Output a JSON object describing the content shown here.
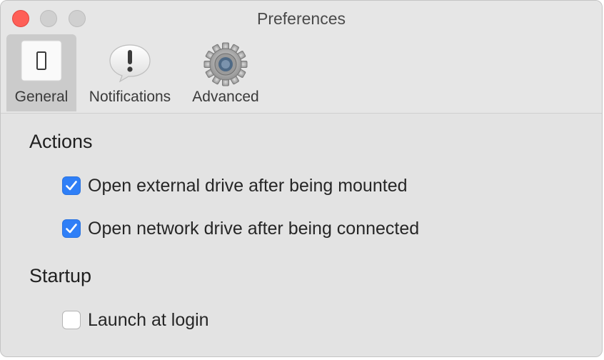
{
  "window": {
    "title": "Preferences"
  },
  "toolbar": {
    "tabs": [
      {
        "label": "General",
        "icon": "switch-icon",
        "selected": true
      },
      {
        "label": "Notifications",
        "icon": "exclamation-bubble-icon",
        "selected": false
      },
      {
        "label": "Advanced",
        "icon": "gear-icon",
        "selected": false
      }
    ]
  },
  "sections": {
    "actions": {
      "title": "Actions",
      "options": [
        {
          "label": "Open external drive after being mounted",
          "checked": true
        },
        {
          "label": "Open network drive after being connected",
          "checked": true
        }
      ]
    },
    "startup": {
      "title": "Startup",
      "options": [
        {
          "label": "Launch at login",
          "checked": false
        }
      ]
    }
  },
  "colors": {
    "accent": "#2f7ff7",
    "close": "#fe5f57",
    "window_bg": "#e3e3e3"
  }
}
